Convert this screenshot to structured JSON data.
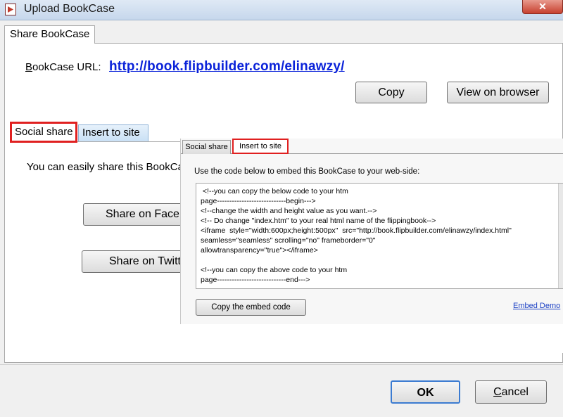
{
  "window": {
    "title": "Upload BookCase",
    "close_symbol": "✕",
    "app_icon": "pdf-icon"
  },
  "outer_tab": {
    "label": "Share BookCase"
  },
  "bookcase": {
    "url_label_prefix": "B",
    "url_label_rest": "ookCase URL:",
    "url": "http://book.flipbuilder.com/elinawzy/"
  },
  "buttons": {
    "copy": "Copy",
    "view_on_browser": "View on browser",
    "share_facebook": "Share on Facebook",
    "share_twitter": "Share on Twitter",
    "ok": "OK",
    "cancel_prefix": "C",
    "cancel_rest": "ancel"
  },
  "inner_tabs": {
    "social_share": "Social share",
    "insert_to_site": "Insert to site"
  },
  "social_text": "You can easily share this BookCase",
  "embed": {
    "tab_social": "Social share",
    "tab_insert": "Insert to site",
    "description": "Use the code below to embed this BookCase to your web-side:",
    "code": " <!--you can copy the below code to your htm\npage----------------------------begin--->\n<!--change the width and height value as you want.-->\n<!-- Do change \"index.htm\" to your real html name of the flippingbook-->\n<iframe  style=\"width:600px;height:500px\"  src=\"http://book.flipbuilder.com/elinawzy/index.html\"\nseamless=\"seamless\" scrolling=\"no\" frameborder=\"0\"\nallowtransparency=\"true\"></iframe>\n\n<!--you can copy the above code to your htm\npage----------------------------end--->",
    "copy_button": "Copy the embed code",
    "demo_link": "Embed Demo"
  },
  "colors": {
    "highlight": "#e02020",
    "link": "#0a22d9"
  }
}
